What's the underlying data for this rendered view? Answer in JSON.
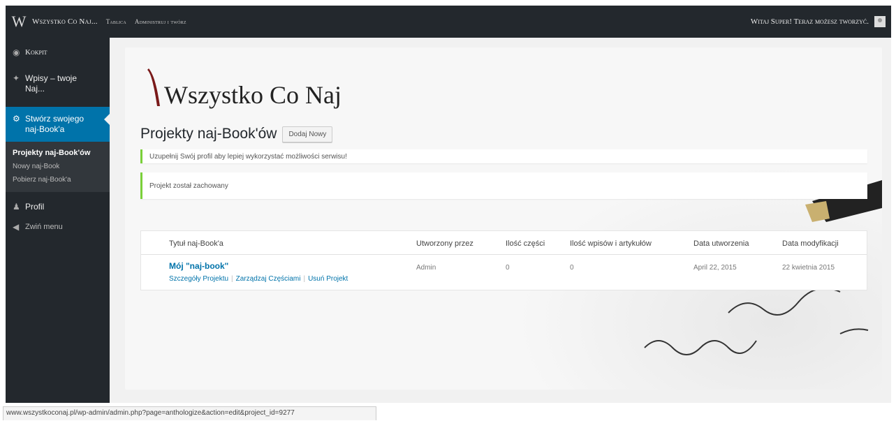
{
  "topbar": {
    "site_name": "Wszystko Co Naj...",
    "dashboard": "Tablica",
    "manage": "Administruj i twórz",
    "greeting": "Witaj Super! Teraz możesz tworzyć."
  },
  "sidebar": {
    "items": [
      {
        "label": "Kokpit",
        "icon": "dashboard-icon"
      },
      {
        "label": "Wpisy – twoje Naj...",
        "icon": "pin-icon"
      },
      {
        "label": "Stwórz swojego naj-Book'a",
        "icon": "gear-icon"
      },
      {
        "label": "Profil",
        "icon": "user-icon"
      },
      {
        "label": "Zwiń menu",
        "icon": "collapse-icon"
      }
    ],
    "submenu": [
      "Projekty naj-Book'ów",
      "Nowy naj-Book",
      "Pobierz naj-Book'a"
    ]
  },
  "logo": {
    "text": "Wszystko Co Naj"
  },
  "page": {
    "title": "Projekty naj-Book'ów",
    "add_button": "Dodaj Nowy"
  },
  "notices": {
    "profile": "Uzupełnij Swój profil aby lepiej wykorzystać możliwości serwisu!",
    "saved": "Projekt został zachowany"
  },
  "table": {
    "headers": [
      "Tytuł naj-Book'a",
      "Utworzony przez",
      "Ilość części",
      "Ilość wpisów i artykułów",
      "Data utworzenia",
      "Data modyfikacji"
    ],
    "rows": [
      {
        "title": "Mój \"naj-book\"",
        "author": "Admin",
        "parts": "0",
        "posts": "0",
        "created": "April 22, 2015",
        "modified": "22 kwietnia 2015",
        "actions": [
          "Szczegóły Projektu",
          "Zarządzaj Częściami",
          "Usuń Projekt"
        ]
      }
    ]
  },
  "statusbar": {
    "url": "www.wszystkoconaj.pl/wp-admin/admin.php?page=anthologize&action=edit&project_id=9277"
  },
  "colors": {
    "adminbar": "#23282d",
    "accent": "#0073aa",
    "notice_success": "#7ad03a"
  }
}
